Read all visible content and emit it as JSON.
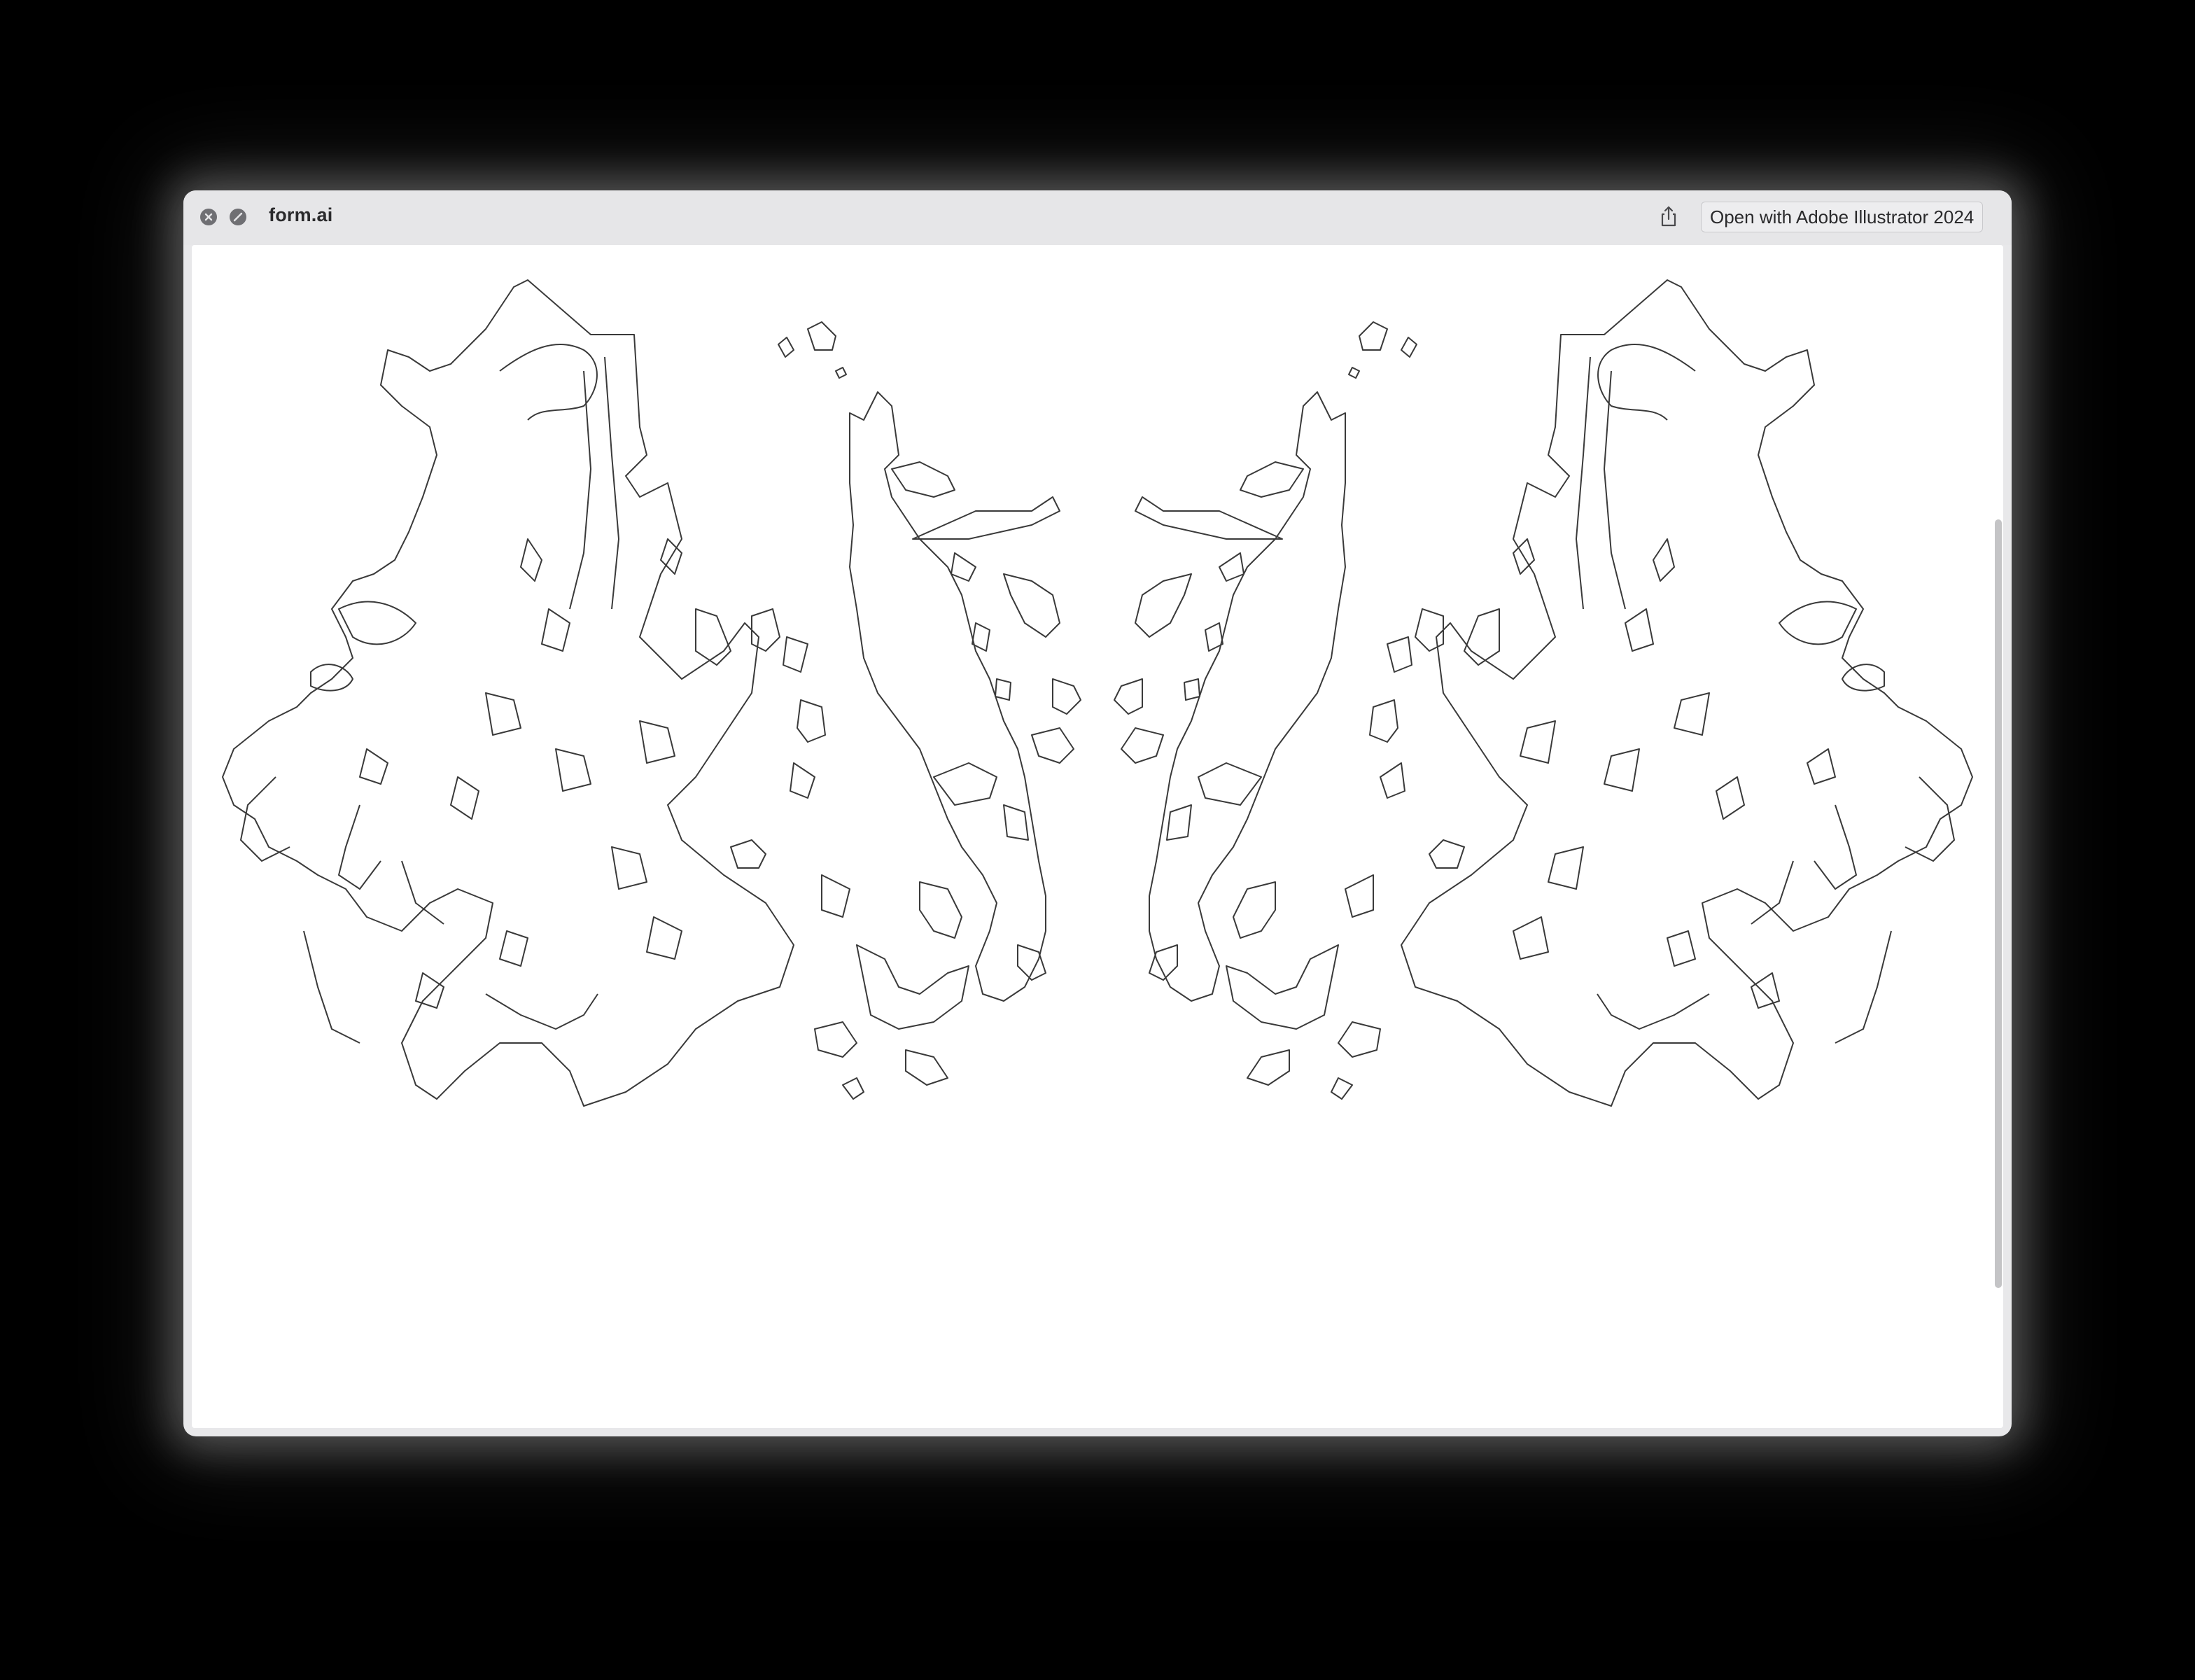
{
  "window": {
    "title": "form.ai",
    "open_with_label": "Open with Adobe Illustrator 2024"
  },
  "icons": {
    "close": "close-icon",
    "fullscreen": "fullscreen-icon",
    "share": "share-icon"
  },
  "colors": {
    "background": "#000000",
    "titlebar": "#e6e6e8",
    "canvas": "#ffffff",
    "stroke": "#3a3a3a"
  }
}
